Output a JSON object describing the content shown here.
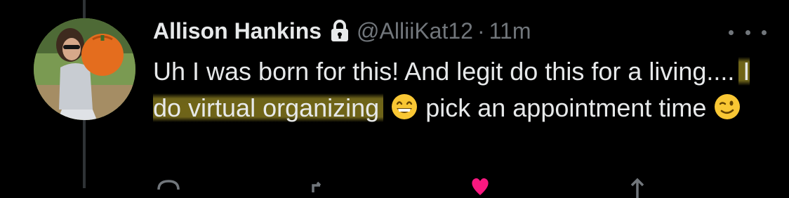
{
  "tweet": {
    "author_name": "Allison Hankins",
    "handle": "@AlliiKat12",
    "separator": "·",
    "time": "11m",
    "text_part1": "Uh I was born for this! And legit do this for a living.... ",
    "text_highlighted": "I do virtual organizing",
    "text_part2": " pick an appointment time",
    "emoji_1": "grinning-face-with-smiling-eyes",
    "emoji_2": "winking-face",
    "highlight_color": "#a89828"
  },
  "icons": {
    "protected": "lock-icon",
    "more": "more-options-icon",
    "reply": "reply-icon",
    "retweet": "retweet-icon",
    "like": "heart-icon",
    "share": "share-icon"
  },
  "colors": {
    "background": "#000000",
    "text": "#e7e9ea",
    "secondary_text": "#71767b",
    "like": "#f91880"
  }
}
